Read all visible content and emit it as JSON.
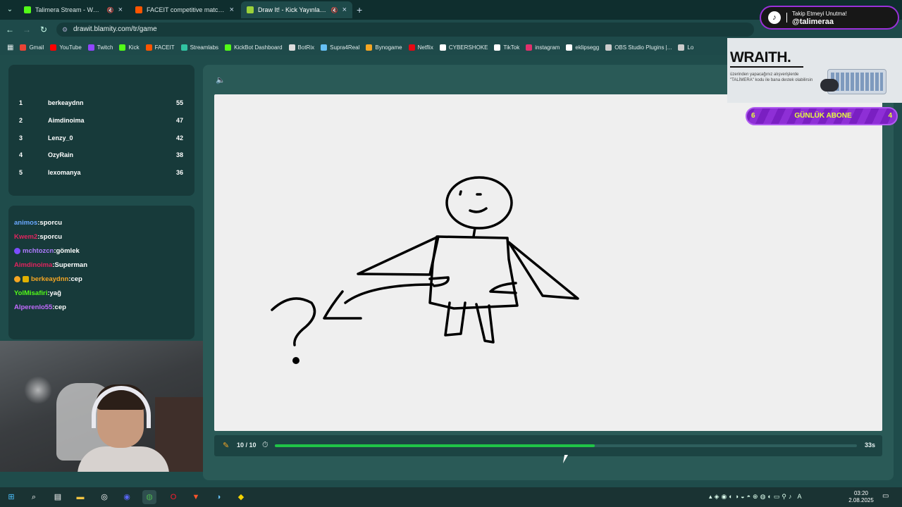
{
  "browser": {
    "tabs": [
      {
        "title": "Talimera Stream - Watch Li",
        "favicon_color": "#53fc18",
        "active": false
      },
      {
        "title": "FACEIT competitive match - FACEIT",
        "favicon_color": "#ff5500",
        "active": false
      },
      {
        "title": "Draw It! - Kick Yayınları İçin",
        "favicon_color": "#9bd13a",
        "active": true
      }
    ],
    "url": "drawit.blamity.com/tr/game",
    "bookmarks": [
      {
        "label": "Gmail",
        "color": "#ea4335"
      },
      {
        "label": "YouTube",
        "color": "#ff0000"
      },
      {
        "label": "Twitch",
        "color": "#9146ff"
      },
      {
        "label": "Kick",
        "color": "#53fc18"
      },
      {
        "label": "FACEIT",
        "color": "#ff5500"
      },
      {
        "label": "Streamlabs",
        "color": "#31c3a2"
      },
      {
        "label": "KickBot Dashboard",
        "color": "#53fc18"
      },
      {
        "label": "BotRix",
        "color": "#dddddd"
      },
      {
        "label": "Supra4Real",
        "color": "#66c0f4"
      },
      {
        "label": "Bynogame",
        "color": "#f5a623"
      },
      {
        "label": "Netflix",
        "color": "#e50914"
      },
      {
        "label": "CYBERSHOKE",
        "color": "#ffffff"
      },
      {
        "label": "TikTok",
        "color": "#ffffff"
      },
      {
        "label": "instagram",
        "color": "#e1306c"
      },
      {
        "label": "eklipsegg",
        "color": "#ffffff"
      },
      {
        "label": "OBS Studio Plugins |...",
        "color": "#cccccc"
      },
      {
        "label": "Lo",
        "color": "#cccccc"
      }
    ]
  },
  "leaderboard": [
    {
      "rank": "1",
      "name": "berkeaydnn",
      "score": "55"
    },
    {
      "rank": "2",
      "name": "Aimdinoima",
      "score": "47"
    },
    {
      "rank": "3",
      "name": "Lenzy_0",
      "score": "42"
    },
    {
      "rank": "4",
      "name": "OzyRain",
      "score": "38"
    },
    {
      "rank": "5",
      "name": "lexomanya",
      "score": "36"
    }
  ],
  "chat": [
    {
      "user": "animos",
      "text": ":sporcu",
      "color": "#6aa8ff"
    },
    {
      "user": "Kwem2",
      "text": ":sporcu",
      "color": "#e0245e"
    },
    {
      "user": "mchtozcn",
      "text": ":gömlek",
      "color": "#b07cff"
    },
    {
      "user": "Aimdinoima",
      "text": ":Superman",
      "color": "#e0245e"
    },
    {
      "user": "berkeaydnn",
      "text": ":cep",
      "color": "#f5a623"
    },
    {
      "user": "YolMisafiri",
      "text": ":yağ",
      "color": "#53fc18"
    },
    {
      "user": "Alperenlo55",
      "text": ":cep",
      "color": "#c36bff"
    }
  ],
  "game": {
    "round": "10 / 10",
    "time_left": "33s",
    "progress": 0.55,
    "progress_color": "#20c447"
  },
  "overlay": {
    "tiktok_line1": "Takip Etmeyi Unutma!",
    "tiktok_handle": "@talimeraa",
    "ad_title": "WRAITH.",
    "ad_text": "üzerinden yapacağınız alışverişlerde \"TALİMERA\" kodu ile bana destek olabilirsin",
    "sub_left": "6",
    "sub_label": "GÜNLÜK ABONE",
    "sub_right": "4"
  },
  "taskbar": {
    "time": "03:20",
    "date": "2.08.2025"
  }
}
